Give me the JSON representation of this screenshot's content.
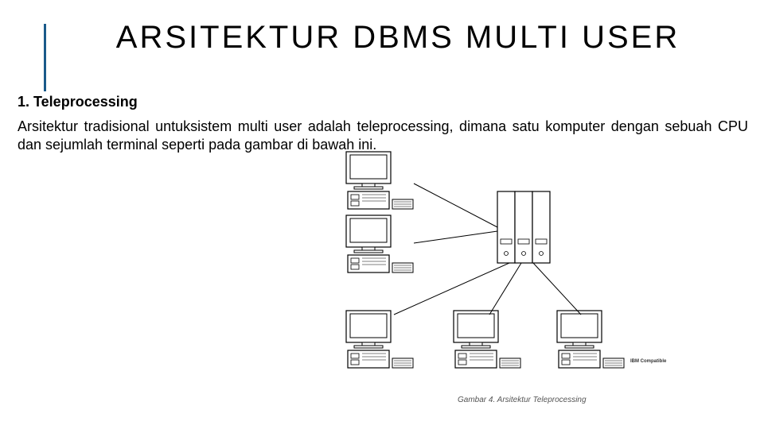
{
  "title": "ARSITEKTUR DBMS MULTI USER",
  "subheading": "1. Teleprocessing",
  "body": "Arsitektur tradisional untuksistem multi user adalah teleprocessing, dimana satu komputer dengan sebuah CPU dan sejumlah terminal seperti pada gambar di bawah ini.",
  "caption": "Gambar 4. Arsitektur Teleprocessing",
  "micro_label": "IBM Compatible"
}
